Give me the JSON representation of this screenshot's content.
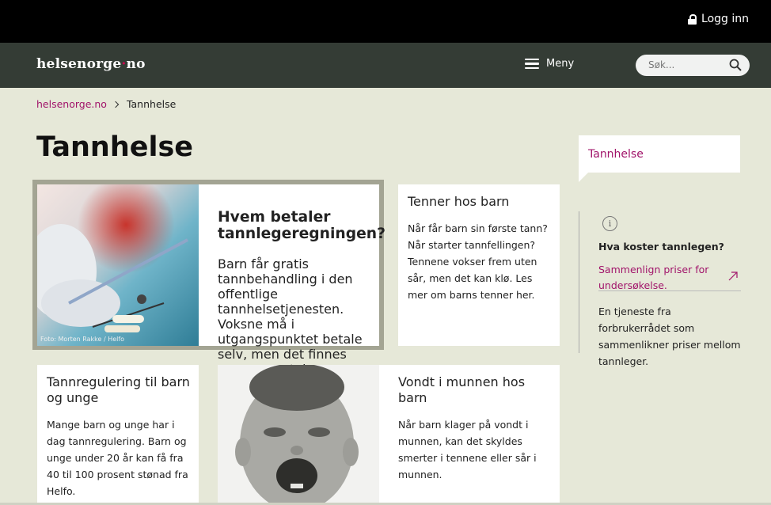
{
  "topbar": {
    "login_label": "Logg inn"
  },
  "navbar": {
    "logo_part1": "helsenorge",
    "logo_dot": "·",
    "logo_part2": "no",
    "menu_label": "Meny",
    "search_placeholder": "Søk..."
  },
  "breadcrumb": {
    "home": "helsenorge.no",
    "current": "Tannhelse"
  },
  "page": {
    "title": "Tannhelse"
  },
  "cards": {
    "featured": {
      "title": "Hvem betaler tannlegeregningen?",
      "text": "Barn får gratis tannbehandling i den offentlige tannhelsetjenesten. Voksne må i utgangspunktet betale selv, men det finnes mange unntak.",
      "photo_credit": "Foto: Morten Rakke / Helfo"
    },
    "children_teeth": {
      "title": "Tenner hos barn",
      "text": "Når får barn sin første tann? Når starter tannfellingen? Tennene vokser frem uten sår, men det kan klø. Les mer om barns tenner her."
    },
    "orthodontics": {
      "title": "Tannregulering til barn og unge",
      "text": "Mange barn og unge har i dag tannregulering. Barn og unge under 20 år kan få fra 40 til 100 prosent stønad fra Helfo."
    },
    "mouth_pain": {
      "title": "Vondt i munnen hos barn",
      "text": "Når barn klager på vondt i munnen, kan det skyldes smerter i tennene eller sår i munnen."
    }
  },
  "sidebar": {
    "tab_label": "Tannhelse",
    "info_heading": "Hva koster tannlegen?",
    "info_link": "Sammenlign priser for undersøkelse.",
    "info_desc": "En tjeneste fra forbrukerrådet som sammenlikner priser mellom tannleger."
  },
  "colors": {
    "accent": "#a1146a",
    "navbar_bg": "#343c35",
    "page_bg": "#e6e8d8",
    "logo_dot": "#d0024f"
  },
  "icons": [
    "lock-icon",
    "menu-icon",
    "search-icon",
    "chevron-right-icon",
    "info-icon",
    "external-arrow-icon"
  ]
}
